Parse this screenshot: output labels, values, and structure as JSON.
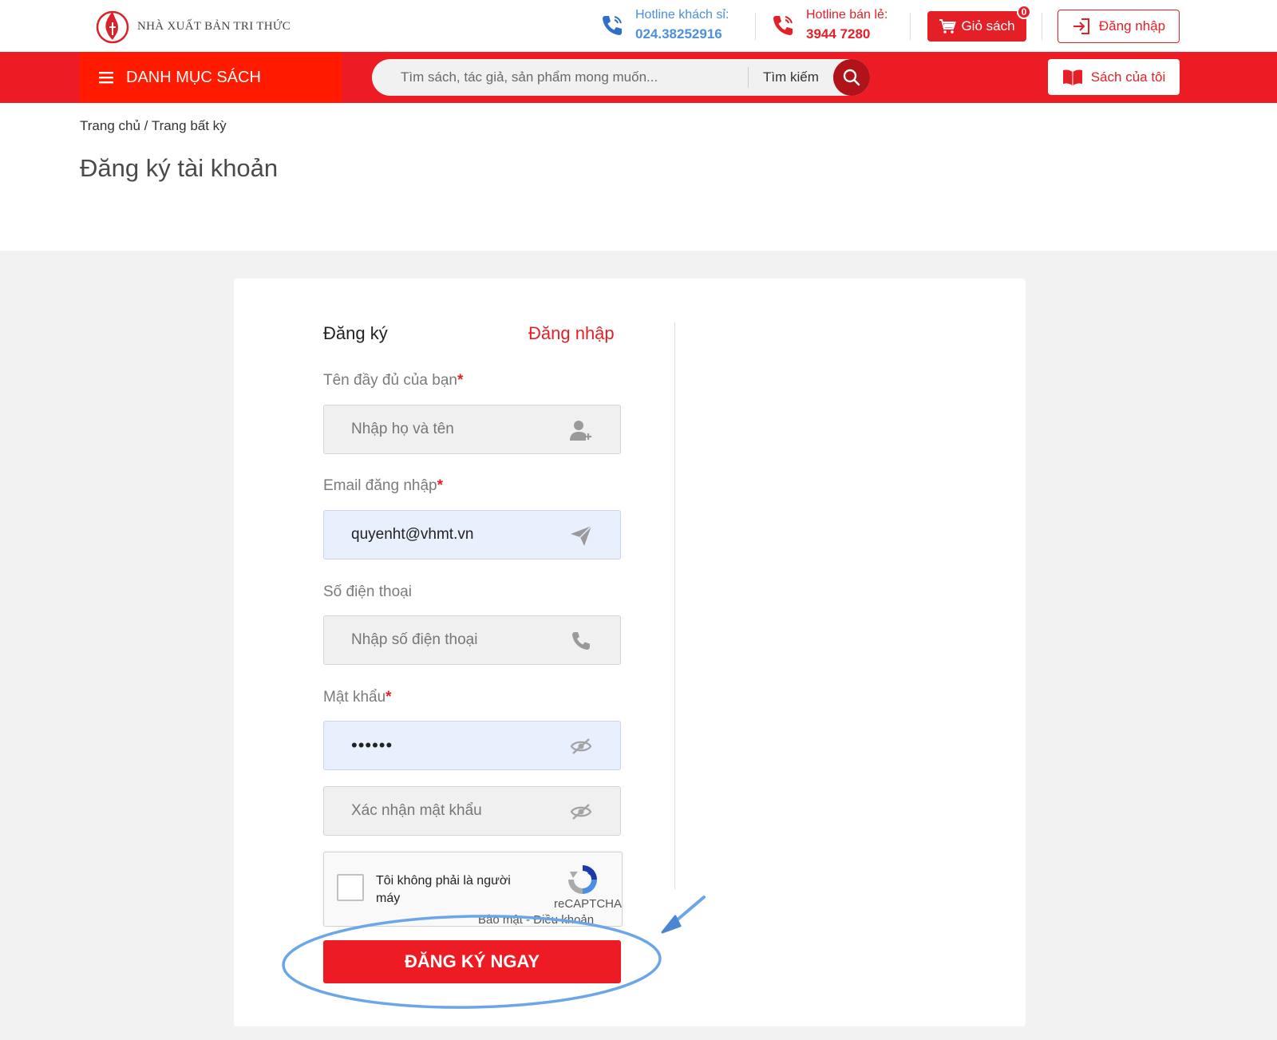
{
  "header": {
    "logo_text": "NHÀ XUẤT BẢN TRI THỨC",
    "hotline_wholesale": {
      "label": "Hotline khách sỉ:",
      "number": "024.38252916"
    },
    "hotline_retail": {
      "label": "Hotline bán lẻ:",
      "number": "3944 7280"
    },
    "cart": {
      "label": "Giỏ sách",
      "count": "0"
    },
    "login_label": "Đăng nhập"
  },
  "nav": {
    "catalog_label": "DANH MỤC SÁCH",
    "search": {
      "placeholder": "Tìm sách, tác giả, sản phẩm mong muốn...",
      "button_label": "Tìm kiếm"
    },
    "my_books_label": "Sách của tôi"
  },
  "breadcrumb": {
    "home": "Trang chủ",
    "separator": "/",
    "current": "Trang bất kỳ"
  },
  "page_title": "Đăng ký tài khoản",
  "form": {
    "tab_signup": "Đăng ký",
    "tab_login": "Đăng nhập",
    "required_mark": "*",
    "full_name": {
      "label": "Tên đầy đủ của bạn",
      "placeholder": "Nhập họ và tên",
      "value": ""
    },
    "email": {
      "label": "Email đăng nhập",
      "placeholder": "",
      "value": "quyenht@vhmt.vn"
    },
    "phone": {
      "label": "Số điện thoại",
      "placeholder": "Nhập số điện thoại",
      "value": ""
    },
    "password": {
      "label": "Mật khẩu",
      "value": "••••••"
    },
    "confirm_password": {
      "placeholder": "Xác nhận mật khẩu",
      "value": ""
    },
    "captcha": {
      "text": "Tôi không phải là người máy",
      "brand": "reCAPTCHA",
      "privacy": "Bảo mật",
      "dash": "-",
      "terms": "Điều khoản"
    },
    "submit_label": "ĐĂNG KÝ NGAY"
  },
  "colors": {
    "brand_red": "#ed1c24",
    "dark_red": "#b01319",
    "hotline_blue": "#4b8fde",
    "annotation_blue": "#6aa6e8"
  }
}
